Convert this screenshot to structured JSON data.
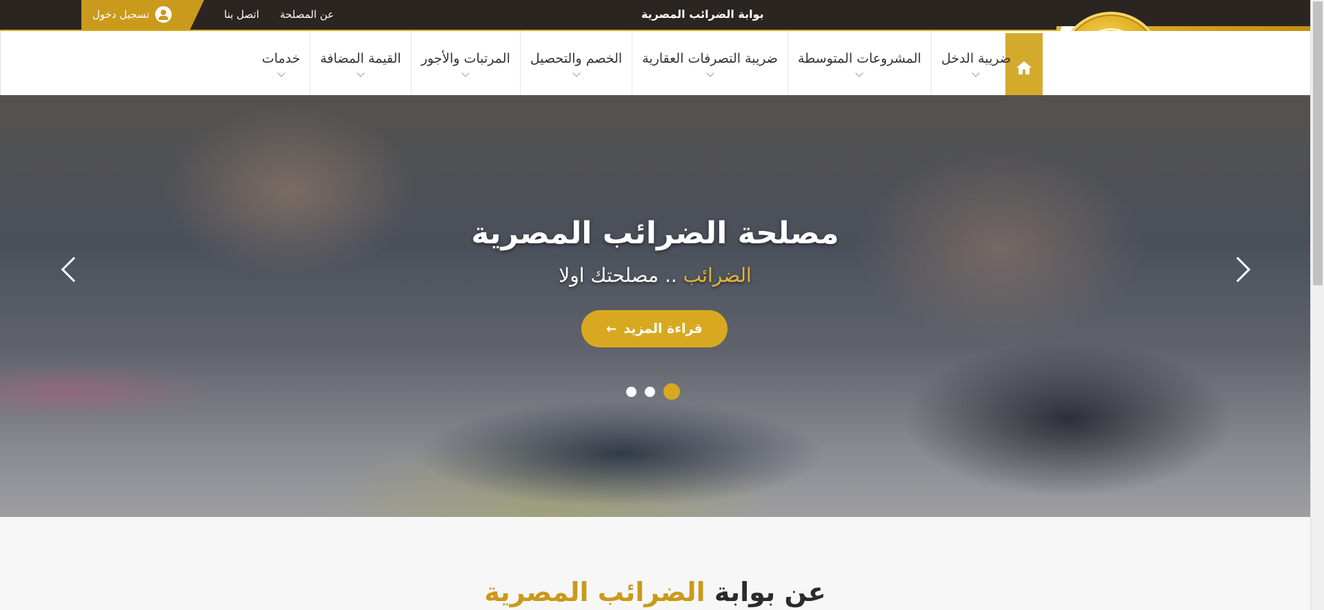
{
  "topbar": {
    "portal_title": "بوابة الضرائب المصرية",
    "login_label": "تسجيل دخول",
    "links": [
      "عن المصلحة",
      "اتصل بنا"
    ]
  },
  "navbar": {
    "items": [
      {
        "label": "ضريبة الدخل"
      },
      {
        "label": "المشروعات المتوسطة"
      },
      {
        "label": "ضريبة التصرفات العقارية"
      },
      {
        "label": "الخصم والتحصيل"
      },
      {
        "label": "المرتبات والأجور"
      },
      {
        "label": "القيمة المضافة"
      },
      {
        "label": "خدمات"
      }
    ]
  },
  "hero": {
    "title": "مصلحة الضرائب المصرية",
    "subtitle_highlight": "الضرائب",
    "subtitle_rest": " .. مصلحتك اولا",
    "button_label": "قراءة المزيد",
    "slides_total": 3,
    "active_slide": 3
  },
  "about": {
    "prefix": "عن بوابة ",
    "highlight": "الضرائب المصرية"
  },
  "colors": {
    "accent_gold": "#d8a920",
    "topbar_dark": "#2b2522"
  },
  "icons": [
    "user-icon",
    "home-icon",
    "chevron-down-icon",
    "arrow-left-icon",
    "chevron-left-icon",
    "chevron-right-icon"
  ]
}
